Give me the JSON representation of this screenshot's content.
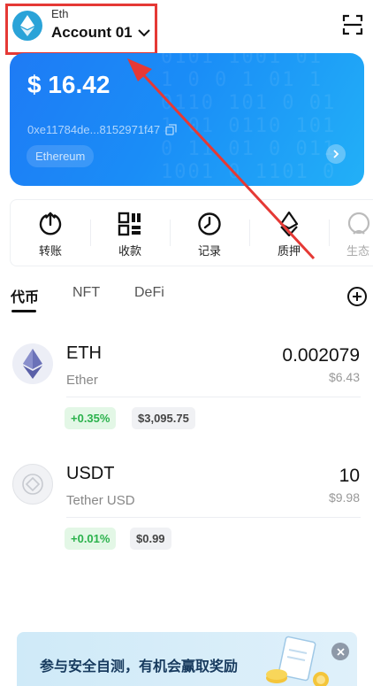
{
  "header": {
    "network": "Eth",
    "account": "Account 01"
  },
  "card": {
    "balance": "$ 16.42",
    "address": "0xe11784de...8152971f47",
    "chain": "Ethereum"
  },
  "actions": [
    {
      "label": "转账",
      "icon": "transfer-icon"
    },
    {
      "label": "收款",
      "icon": "qrcode-icon"
    },
    {
      "label": "记录",
      "icon": "history-icon"
    },
    {
      "label": "质押",
      "icon": "eth-stake-icon"
    },
    {
      "label": "生态",
      "icon": "ecosystem-icon"
    }
  ],
  "tabs": [
    "代币",
    "NFT",
    "DeFi"
  ],
  "tokens": [
    {
      "symbol": "ETH",
      "name": "Ether",
      "amount": "0.002079",
      "fiat": "$6.43",
      "change": "+0.35%",
      "price": "$3,095.75"
    },
    {
      "symbol": "USDT",
      "name": "Tether USD",
      "amount": "10",
      "fiat": "$9.98",
      "change": "+0.01%",
      "price": "$0.99"
    }
  ],
  "banner": {
    "text": "参与安全自测，有机会赢取奖励"
  },
  "colors": {
    "card_start": "#1e7bf5",
    "card_end": "#22b0f7",
    "positive": "#2bb24c",
    "annotation": "#e53935"
  }
}
